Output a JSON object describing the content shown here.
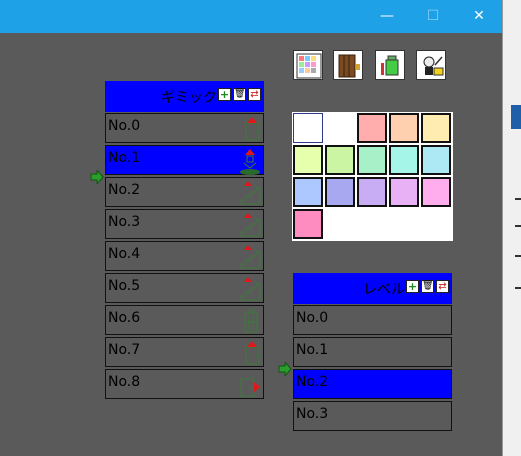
{
  "window": {
    "minimize_glyph": "—",
    "maximize_glyph": "☐",
    "close_glyph": "✕",
    "titlebar_color": "#1fa1e8"
  },
  "toolbar": {
    "tools": [
      "grid-tool-icon",
      "door-tool-icon",
      "item-tool-icon",
      "character-tool-icon"
    ]
  },
  "gimmick_panel": {
    "title": "ギミック",
    "add_glyph": "+",
    "delete_glyph": "🗑",
    "refresh_glyph": "⇄",
    "selected_index": 1,
    "items": [
      {
        "label": "No.0",
        "icon": "door-red-top-icon"
      },
      {
        "label": "No.1",
        "icon": "warp-icon"
      },
      {
        "label": "No.2",
        "icon": "stairs-up-icon"
      },
      {
        "label": "No.3",
        "icon": "stairs-up-icon"
      },
      {
        "label": "No.4",
        "icon": "stairs-up-icon"
      },
      {
        "label": "No.5",
        "icon": "stairs-up-icon"
      },
      {
        "label": "No.6",
        "icon": "trash-can-icon"
      },
      {
        "label": "No.7",
        "icon": "door-red-top-icon"
      },
      {
        "label": "No.8",
        "icon": "door-red-right-icon"
      }
    ]
  },
  "level_panel": {
    "title": "レベル",
    "add_glyph": "+",
    "delete_glyph": "🗑",
    "refresh_glyph": "⇄",
    "selected_index": 2,
    "items": [
      {
        "label": "No.0"
      },
      {
        "label": "No.1"
      },
      {
        "label": "No.2"
      },
      {
        "label": "No.3"
      }
    ]
  },
  "palette": {
    "colors": [
      "#ffffff",
      "#ffffff",
      "#ffadad",
      "#ffd0b0",
      "#ffecb0",
      "#e6ffad",
      "#cbf5a3",
      "#a8f0c8",
      "#a5f5e8",
      "#ade8f5",
      "#adc8ff",
      "#a8a8f0",
      "#c8adf5",
      "#e8b0f5",
      "#ffaded",
      "#ff8cc0"
    ],
    "selected_index": 0
  },
  "colors": {
    "selection": "#0000ff",
    "background": "#5a5a5a",
    "pointer_arrow": "#2a9d2a"
  }
}
